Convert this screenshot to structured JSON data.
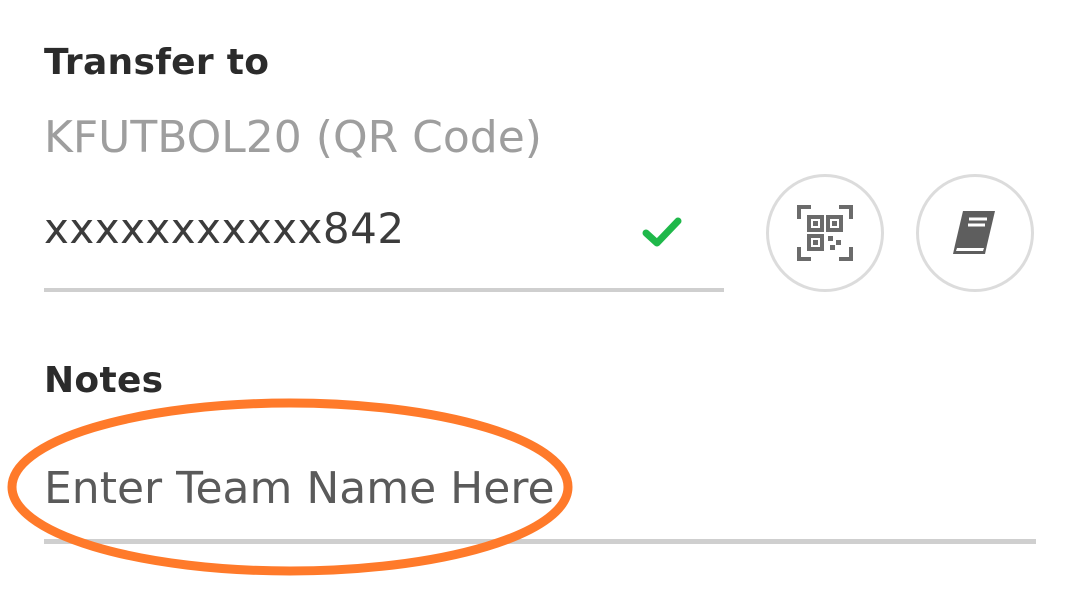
{
  "transfer": {
    "label": "Transfer to",
    "recipient_name": "KFUTBOL20 (QR Code)",
    "account_number": "xxxxxxxxxxx842",
    "account_status_icon": "check-icon",
    "scan_qr_icon": "qr-code-icon",
    "address_book_icon": "address-book-icon"
  },
  "notes": {
    "label": "Notes",
    "placeholder": "Enter Team Name Here",
    "value": ""
  },
  "colors": {
    "check": "#1fb84a",
    "annotation": "#ff7a2a",
    "underline": "#cfcfcf"
  }
}
